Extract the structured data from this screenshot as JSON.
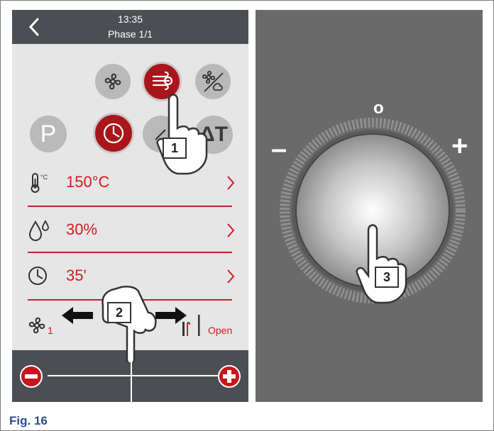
{
  "header": {
    "time": "13:35",
    "phase": "Phase 1/1"
  },
  "mode_buttons": [
    {
      "icon": "fan-icon",
      "active": false
    },
    {
      "icon": "fan-steam-icon",
      "active": true
    },
    {
      "icon": "fan-off-icon",
      "active": false
    }
  ],
  "second_row_buttons": {
    "program_label": "P",
    "timer_active": true,
    "delta_t_label": "ΔT"
  },
  "parameters": {
    "temperature": {
      "value": "150°C",
      "unit_icon_label": "°C"
    },
    "humidity": {
      "value": "30%"
    },
    "time": {
      "value": "35'"
    }
  },
  "air_row": {
    "fan_level": "1",
    "vent_label": "Open"
  },
  "knob": {
    "top_mark": "o",
    "minus": "–",
    "plus": "+"
  },
  "callouts": [
    "1",
    "2",
    "3"
  ],
  "caption": "Fig. 16",
  "colors": {
    "accent_red": "#d4191f",
    "bar_dark": "#4b4f53",
    "panel_gray": "#6a6a6a"
  }
}
